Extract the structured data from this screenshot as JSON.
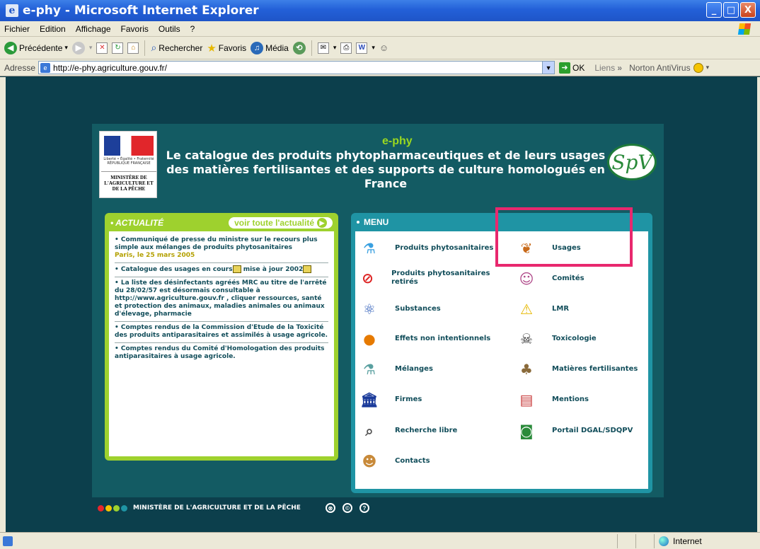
{
  "window": {
    "title": "e-phy - Microsoft Internet Explorer",
    "controls": [
      "_",
      "□",
      "X"
    ]
  },
  "menubar": [
    "Fichier",
    "Edition",
    "Affichage",
    "Favoris",
    "Outils",
    "?"
  ],
  "toolbar": {
    "back_label": "Précédente",
    "search_label": "Rechercher",
    "favorites_label": "Favoris",
    "media_label": "Média"
  },
  "address": {
    "label": "Adresse",
    "url": "http://e-phy.agriculture.gouv.fr/",
    "go_label": "OK",
    "links_label": "Liens",
    "links_chevron": "»",
    "norton_label": "Norton AntiVirus"
  },
  "header": {
    "brand": "e-phy",
    "title": "Le catalogue des produits phytopharmaceutiques et de leurs usages des matières fertilisantes et des supports de culture homologués en France",
    "ministry_logo_motto": "Liberté • Égalité • Fraternité RÉPUBLIQUE FRANÇAISE",
    "ministry_logo_name": "MINISTÈRE DE L'AGRICULTURE ET DE LA PÊCHE",
    "spv_logo": "SpV"
  },
  "news": {
    "heading": "ACTUALITÉ",
    "all_link": "voir toute l'actualité",
    "items": [
      {
        "text": "Communiqué de presse du ministre sur le recours plus simple aux mélanges de produits phytosanitaires",
        "date": "Paris, le 25 mars 2005"
      },
      {
        "text": "Catalogue des usages en cours",
        "suffix": "mise à jour 2002"
      },
      {
        "text": "La liste des désinfectants agréés MRC au titre de l'arrêté du 28/02/57 est désormais consultable à http://www.agriculture.gouv.fr , cliquer ressources, santé et protection des animaux, maladies animales ou animaux d'élevage, pharmacie"
      },
      {
        "text": "Comptes rendus de la Commission d'Etude de la Toxicité des produits antiparasitaires et assimilés à usage agricole."
      },
      {
        "text": "Comptes rendus du Comité d'Homologation des produits antiparasitaires à usage agricole."
      }
    ]
  },
  "menu": {
    "heading": "MENU",
    "left": [
      {
        "label": "Produits phytosanitaires",
        "icon": "flask-icon"
      },
      {
        "label": "Produits phytosanitaires retirés",
        "icon": "flask-forbidden-icon"
      },
      {
        "label": "Substances",
        "icon": "molecule-icon"
      },
      {
        "label": "Effets non intentionnels",
        "icon": "pumpkin-icon"
      },
      {
        "label": "Mélanges",
        "icon": "beaker-icon"
      },
      {
        "label": "Firmes",
        "icon": "building-icon"
      },
      {
        "label": "Recherche libre",
        "icon": "magnifier-icon"
      },
      {
        "label": "Contacts",
        "icon": "person-icon"
      }
    ],
    "right": [
      {
        "label": "Usages",
        "icon": "cornucopia-icon"
      },
      {
        "label": "Comités",
        "icon": "people-icon"
      },
      {
        "label": "LMR",
        "icon": "warning-icon"
      },
      {
        "label": "Toxicologie",
        "icon": "poison-icon"
      },
      {
        "label": "Matières fertilisantes",
        "icon": "sack-icon"
      },
      {
        "label": "Mentions",
        "icon": "document-icon"
      },
      {
        "label": "Portail DGAL/SDQPV",
        "icon": "portal-icon"
      }
    ]
  },
  "footer": {
    "text": "MINISTÈRE DE L'AGRICULTURE ET DE LA PÊCHE",
    "dot_colors": [
      "#e8262b",
      "#f5c400",
      "#9ed12e",
      "#1f94a4"
    ]
  },
  "status": {
    "zone_label": "Internet"
  },
  "colors": {
    "accent_green": "#9ed12e",
    "menu_teal": "#1f94a4",
    "highlight": "#e8286e"
  }
}
